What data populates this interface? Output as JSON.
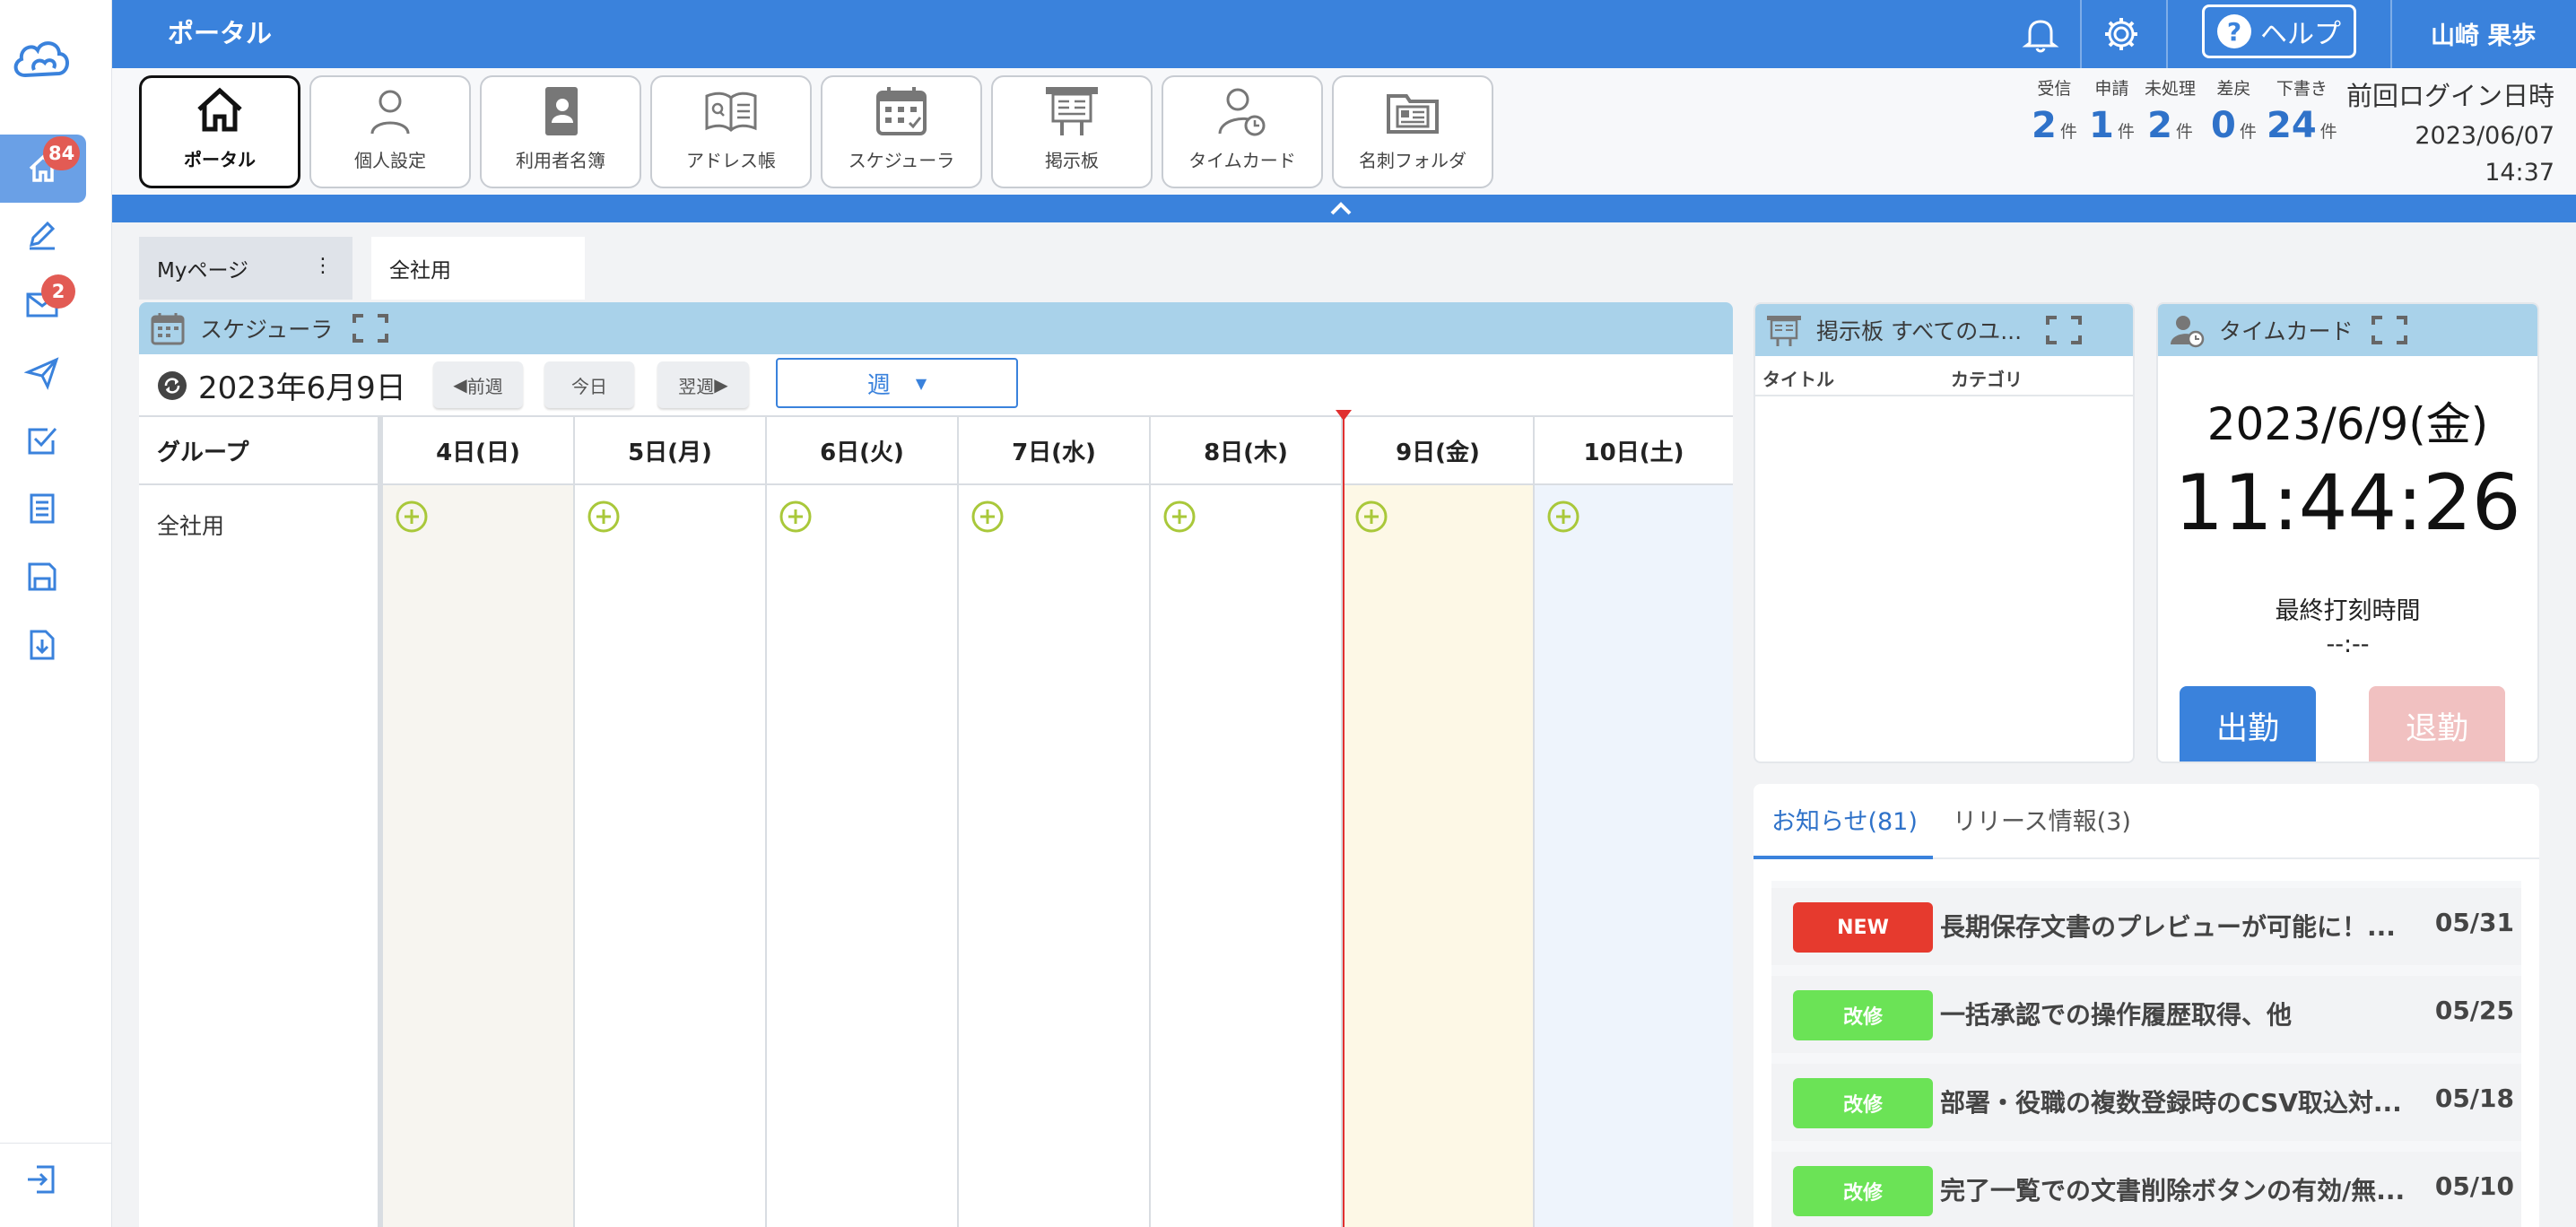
{
  "topbar": {
    "title": "ポータル",
    "help_label": "ヘルプ",
    "help_q": "?",
    "user_name": "山崎 果歩"
  },
  "rail": {
    "home_badge": "84",
    "mail_badge": "2"
  },
  "toolbar": {
    "items": [
      {
        "label": "ポータル",
        "icon": "home-icon"
      },
      {
        "label": "個人設定",
        "icon": "person-icon"
      },
      {
        "label": "利用者名簿",
        "icon": "directory-icon"
      },
      {
        "label": "アドレス帳",
        "icon": "address-book-icon"
      },
      {
        "label": "スケジューラ",
        "icon": "calendar-icon"
      },
      {
        "label": "掲示板",
        "icon": "bulletin-board-icon"
      },
      {
        "label": "タイムカード",
        "icon": "timecard-icon"
      },
      {
        "label": "名刺フォルダ",
        "icon": "business-card-folder-icon"
      }
    ],
    "counters": [
      {
        "header": "受信",
        "value": "2",
        "unit": "件"
      },
      {
        "header": "申請",
        "value": "1",
        "unit": "件"
      },
      {
        "header": "未処理",
        "value": "2",
        "unit": "件"
      },
      {
        "header": "差戻",
        "value": "0",
        "unit": "件"
      },
      {
        "header": "下書き",
        "value": "24",
        "unit": "件"
      }
    ],
    "last_login_label": "前回ログイン日時",
    "last_login_date": "2023/06/07",
    "last_login_time": "14:37"
  },
  "page_tabs": {
    "my": "Myページ",
    "my_menu": "⋮",
    "all": "全社用"
  },
  "scheduler": {
    "title": "スケジューラ",
    "current_date": "2023年6月9日",
    "prev_label": "前週",
    "today_label": "今日",
    "next_label": "翌週",
    "view_label": "週",
    "group_header": "グループ",
    "group_name": "全社用",
    "days": [
      "4日(日)",
      "5日(月)",
      "6日(火)",
      "7日(水)",
      "8日(木)",
      "9日(金)",
      "10日(土)"
    ]
  },
  "board": {
    "title": "掲示板  すべてのユ...",
    "col_title": "タイトル",
    "col_category": "カテゴリ"
  },
  "timecard": {
    "title": "タイムカード",
    "date": "2023/6/9(金)",
    "time": "11:44:26",
    "last_label": "最終打刻時間",
    "last_value": "--:--",
    "clock_in": "出勤",
    "clock_out": "退勤"
  },
  "news": {
    "tab_notice": "お知らせ(81)",
    "tab_release": "リリース情報(3)",
    "items": [
      {
        "badge": "NEW",
        "title": "長期保存文書のプレビューが可能に！...",
        "date": "05/31"
      },
      {
        "badge": "改修",
        "title": "一括承認での操作履歴取得、他",
        "date": "05/25"
      },
      {
        "badge": "改修",
        "title": "部署・役職の複数登録時のCSV取込対...",
        "date": "05/18"
      },
      {
        "badge": "改修",
        "title": "完了一覧での文書削除ボタンの有効/無...",
        "date": "05/10"
      }
    ]
  },
  "colors": {
    "primary": "#3a82dc",
    "panel_header": "#a9d2ea",
    "badge_new": "#e63a2e",
    "badge_fix": "#6be356",
    "now_line": "#e03030"
  }
}
